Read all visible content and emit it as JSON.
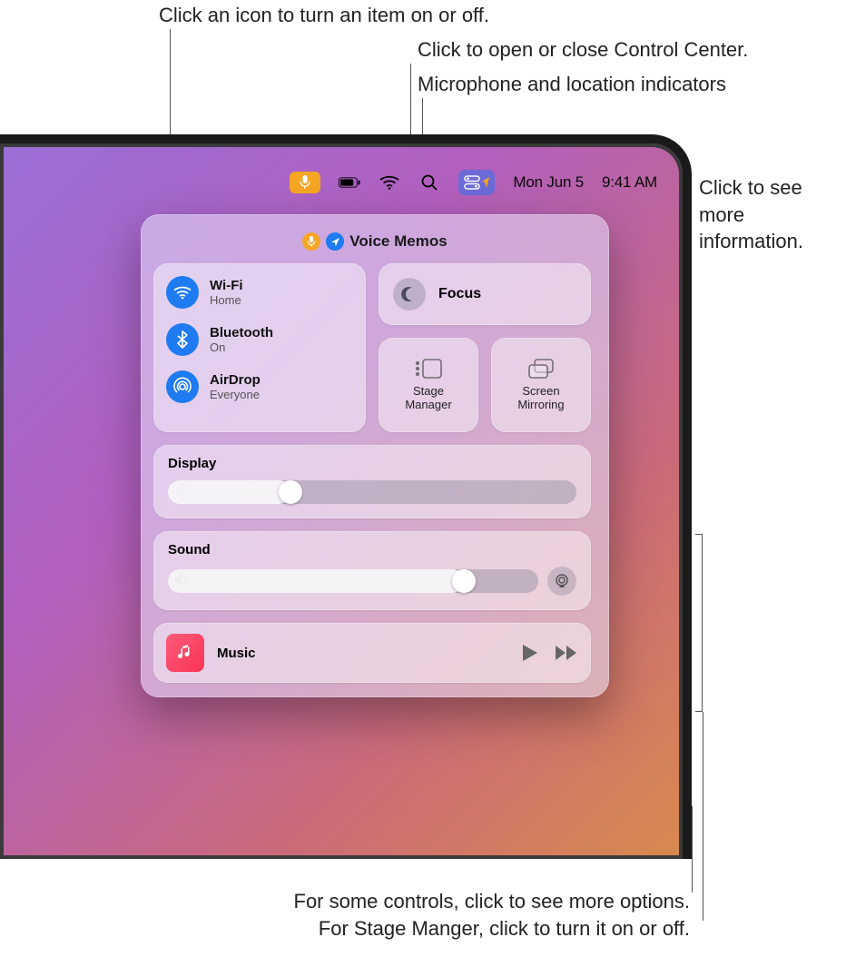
{
  "callouts": {
    "toggle_item": "Click an icon to turn an item on or off.",
    "open_cc": "Click to open or close Control Center.",
    "indicators": "Microphone and location indicators",
    "see_more": "Click to see more information.",
    "bottom1": "For some controls, click to see more options.",
    "bottom2": "For Stage Manger, click to turn it on or off."
  },
  "menubar": {
    "date": "Mon Jun 5",
    "time": "9:41 AM"
  },
  "privacy": {
    "app": "Voice Memos"
  },
  "connectivity": {
    "wifi": {
      "title": "Wi-Fi",
      "subtitle": "Home"
    },
    "bluetooth": {
      "title": "Bluetooth",
      "subtitle": "On"
    },
    "airdrop": {
      "title": "AirDrop",
      "subtitle": "Everyone"
    }
  },
  "focus": {
    "label": "Focus"
  },
  "stage_manager": {
    "line1": "Stage",
    "line2": "Manager"
  },
  "screen_mirroring": {
    "line1": "Screen",
    "line2": "Mirroring"
  },
  "display": {
    "label": "Display",
    "value_pct": 30
  },
  "sound": {
    "label": "Sound",
    "value_pct": 80
  },
  "music": {
    "label": "Music"
  }
}
